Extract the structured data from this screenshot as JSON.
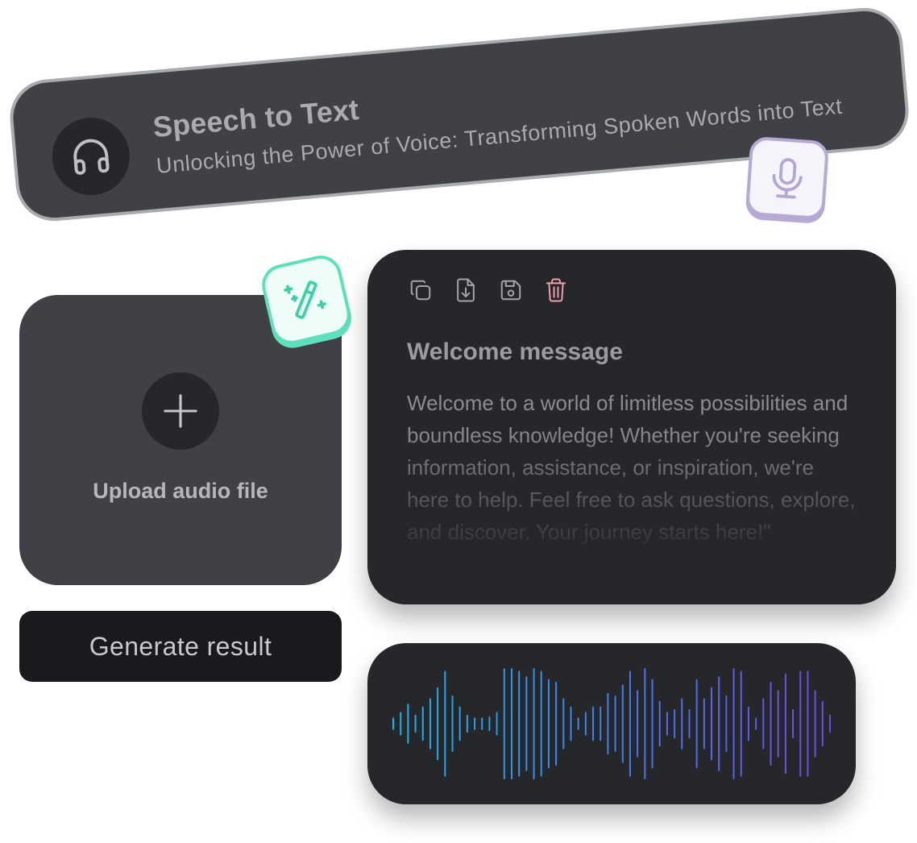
{
  "header": {
    "title": "Speech to Text",
    "subtitle": "Unlocking the Power of Voice: Transforming Spoken Words into Text",
    "avatar_icon": "headphones-icon",
    "badge_icon": "microphone-icon"
  },
  "upload": {
    "label": "Upload audio file",
    "icon": "plus-icon",
    "badge_icon": "magic-wand-icon"
  },
  "actions": {
    "generate_label": "Generate result"
  },
  "result": {
    "toolbar": [
      "copy-icon",
      "download-icon",
      "save-icon",
      "trash-icon"
    ],
    "title": "Welcome message",
    "body": "Welcome to a world of limitless possibilities and boundless knowledge! Whether you're seeking information, assistance, or inspiration, we're here to help. Feel free to ask questions, explore, and discover. Your journey starts here!\""
  },
  "waveform": {
    "amplitudes": [
      0.1,
      0.2,
      0.35,
      0.15,
      0.3,
      0.45,
      0.65,
      0.95,
      0.5,
      0.3,
      0.15,
      0.1,
      0.1,
      0.12,
      0.2,
      1.0,
      1.0,
      0.95,
      0.85,
      1.0,
      0.95,
      0.8,
      0.75,
      0.45,
      0.3,
      0.1,
      0.2,
      0.3,
      0.3,
      0.55,
      0.5,
      0.7,
      0.95,
      0.6,
      1.0,
      0.8,
      0.4,
      0.2,
      0.25,
      0.45,
      0.25,
      0.8,
      0.45,
      0.65,
      0.85,
      0.5,
      1.0,
      0.95,
      0.3,
      0.1,
      0.45,
      0.75,
      0.6,
      0.9,
      0.25,
      0.95,
      0.95,
      0.6,
      0.4,
      0.15
    ],
    "gradient": [
      "#19b4e8",
      "#7048e8"
    ]
  },
  "colors": {
    "wand_accent": "#5fe0bd",
    "mic_accent": "#b6a9d6",
    "trash_accent": "#f0a0ac"
  }
}
